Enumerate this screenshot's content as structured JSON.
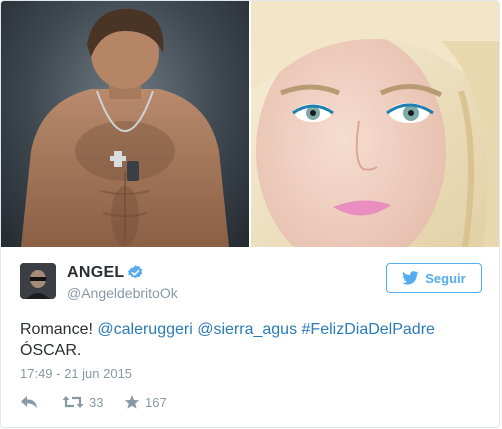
{
  "tweet": {
    "author_name": "ANGEL",
    "handle": "@AngeldebritoOk",
    "follow_label": "Seguir",
    "text_intro": "Romance!",
    "mentions": [
      "@caleruggeri",
      "@sierra_agus"
    ],
    "hashtag": "#FelizDiaDelPadre",
    "signature": "ÓSCAR.",
    "timestamp": "17:49 - 21 jun 2015",
    "retweet_count": "33",
    "favorite_count": "167"
  },
  "photos": [
    {
      "description_icon": "photo-shirtless-man"
    },
    {
      "description_icon": "photo-blonde-woman"
    }
  ],
  "colors": {
    "link": "#2b7bb9",
    "accent": "#55acee",
    "muted": "#8899a6",
    "text": "#292f33",
    "border": "#e1e8ed"
  }
}
